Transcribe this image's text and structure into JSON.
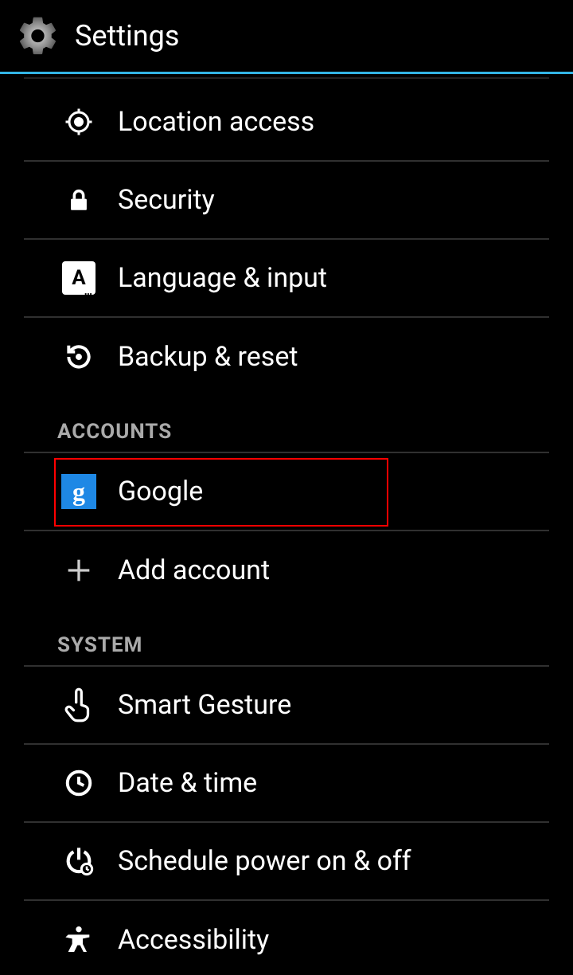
{
  "header": {
    "title": "Settings"
  },
  "items_top": [
    {
      "label": "Location access",
      "icon": "location-icon"
    },
    {
      "label": "Security",
      "icon": "lock-icon"
    },
    {
      "label": "Language & input",
      "icon": "language-icon"
    },
    {
      "label": "Backup & reset",
      "icon": "backup-icon"
    }
  ],
  "section_accounts": "ACCOUNTS",
  "items_accounts": [
    {
      "label": "Google",
      "icon": "google-icon",
      "highlighted": true
    },
    {
      "label": "Add account",
      "icon": "plus-icon"
    }
  ],
  "section_system": "SYSTEM",
  "items_system": [
    {
      "label": "Smart Gesture",
      "icon": "gesture-icon"
    },
    {
      "label": "Date & time",
      "icon": "clock-icon"
    },
    {
      "label": "Schedule power on & off",
      "icon": "power-schedule-icon"
    },
    {
      "label": "Accessibility",
      "icon": "accessibility-icon"
    }
  ]
}
